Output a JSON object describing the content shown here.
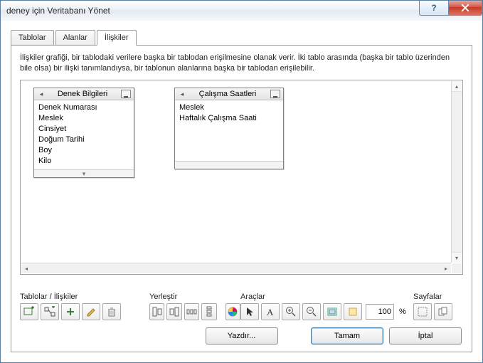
{
  "window": {
    "title": "deney için Veritabanı Yönet"
  },
  "tabs": [
    {
      "label": "Tablolar"
    },
    {
      "label": "Alanlar"
    },
    {
      "label": "İlişkiler"
    }
  ],
  "description": "İlişkiler grafiği, bir tablodaki verilere başka bir tablodan erişilmesine olanak verir. İki tablo arasında (başka bir tablo üzerinden bile olsa) bir ilişki tanımlandıysa, bir tablonun alanlarına başka bir tablodan erişilebilir.",
  "tables": {
    "t1": {
      "name": "Denek Bilgileri",
      "fields": [
        "Denek Numarası",
        "Meslek",
        "Cinsiyet",
        "Doğum Tarihi",
        "Boy",
        "Kilo"
      ]
    },
    "t2": {
      "name": "Çalışma Saatleri",
      "fields": [
        "Meslek",
        "Haftalık Çalışma Saati"
      ]
    }
  },
  "toolbars": {
    "tables_label": "Tablolar / İlişkiler",
    "place_label": "Yerleştir",
    "tools_label": "Araçlar",
    "pages_label": "Sayfalar",
    "zoom_value": "100",
    "zoom_unit": "%"
  },
  "buttons": {
    "print": "Yazdır...",
    "ok": "Tamam",
    "cancel": "İptal"
  }
}
